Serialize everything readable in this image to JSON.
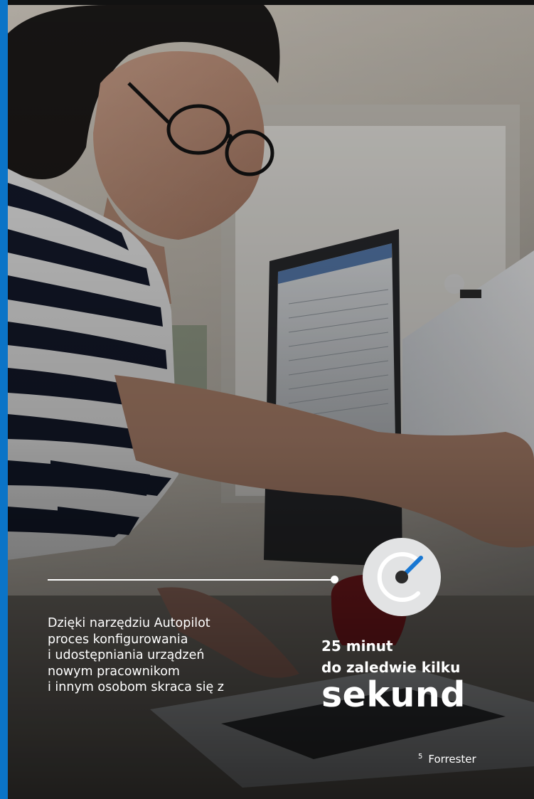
{
  "body_text": {
    "lines": [
      "Dzięki narzędziu Autopilot",
      "proces konfigurowania",
      "i udostępniania urządzeń",
      "nowym pracownikom",
      "i innym osobom skraca się z"
    ]
  },
  "stat": {
    "line1": "25 minut",
    "line2": "do zaledwie kilku",
    "big": "sekund"
  },
  "footnote": {
    "marker": "5",
    "source": "Forrester"
  },
  "icons": {
    "gauge": "speedometer-gauge-icon"
  },
  "colors": {
    "accent": "#0b74c7",
    "gauge_needle": "#1877d2",
    "gauge_disc": "#e2e3e4"
  }
}
